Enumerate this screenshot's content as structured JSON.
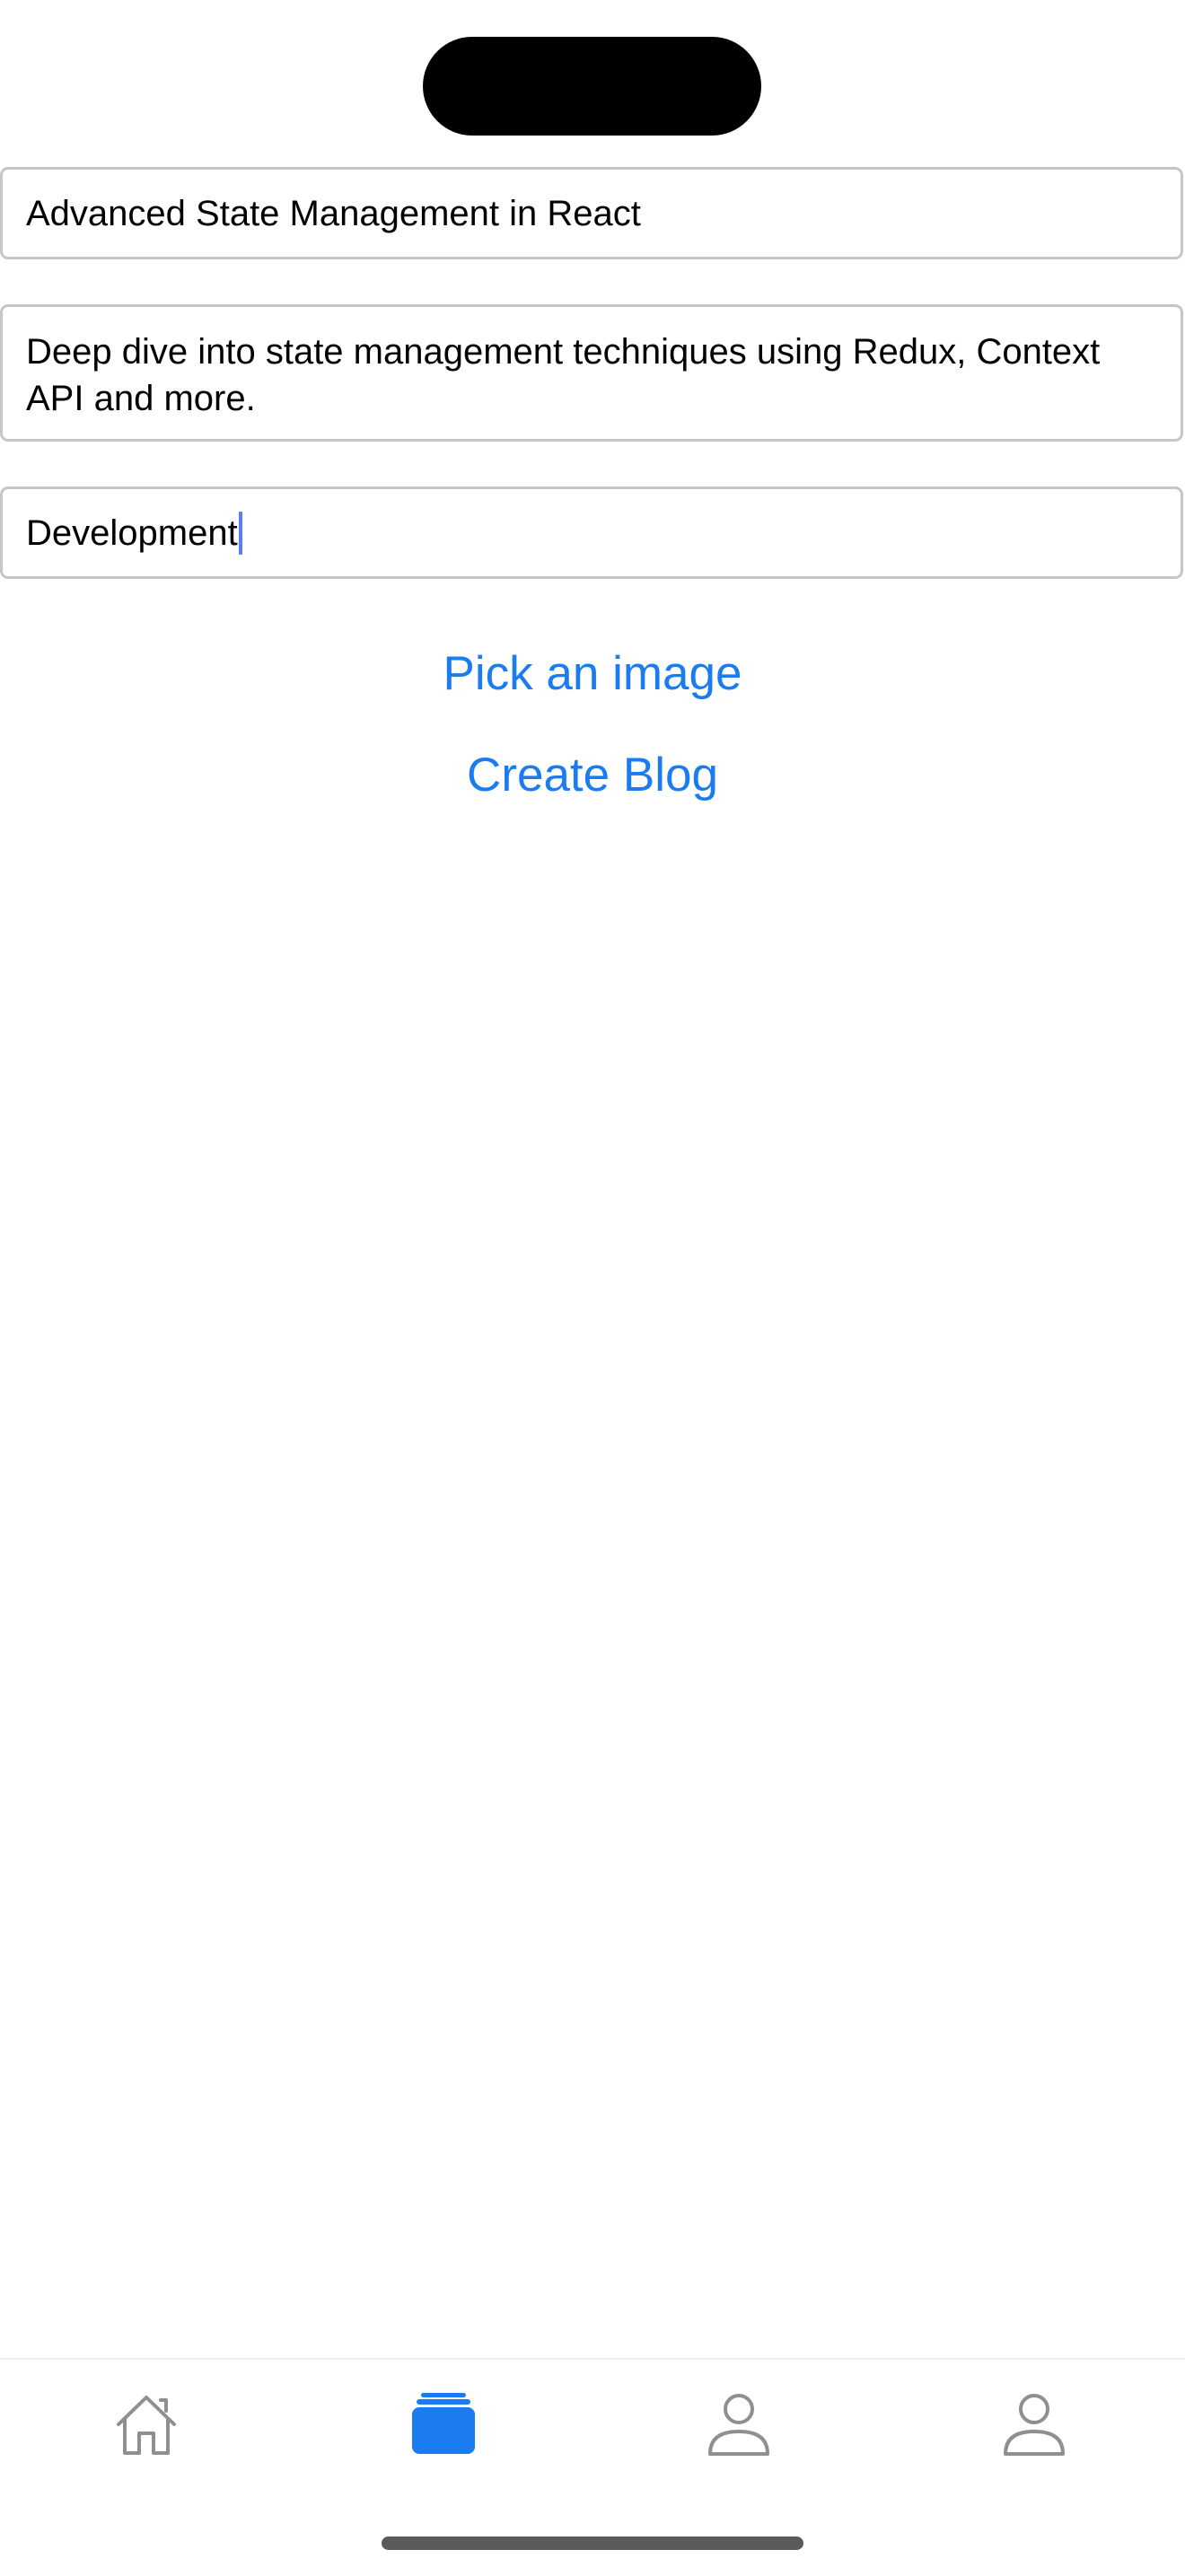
{
  "form": {
    "title_value": "Advanced State Management in React",
    "description_value": "Deep dive into state management techniques using Redux, Context API and more.",
    "category_value": "Development"
  },
  "actions": {
    "pick_image_label": "Pick an image",
    "create_blog_label": "Create Blog"
  },
  "tabbar": {
    "items": [
      {
        "icon": "home-icon",
        "active": false
      },
      {
        "icon": "stack-icon",
        "active": true
      },
      {
        "icon": "person-icon",
        "active": false
      },
      {
        "icon": "person-icon",
        "active": false
      }
    ]
  },
  "colors": {
    "accent": "#1a7cf0",
    "inactive_icon": "#8e8e93",
    "field_border": "#c6c6c8",
    "caret": "#5c7ff0"
  }
}
